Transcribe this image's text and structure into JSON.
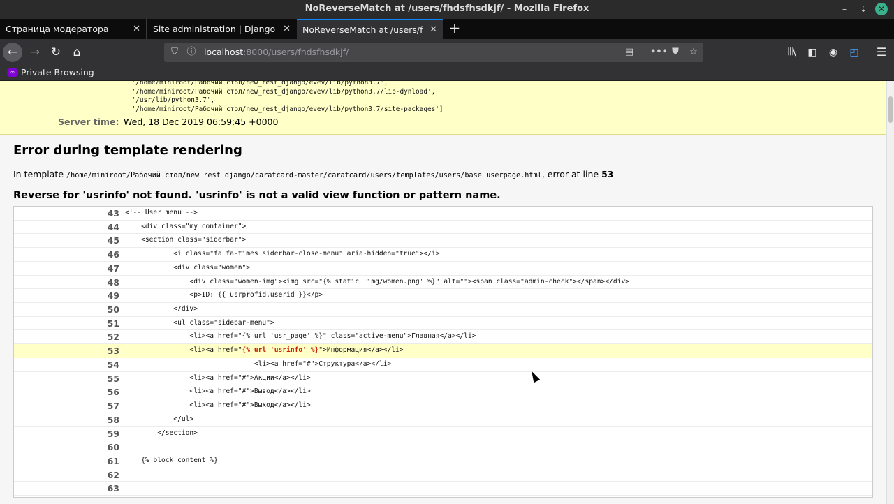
{
  "window": {
    "title": "NoReverseMatch at /users/fhdsfhsdkjf/ - Mozilla Firefox",
    "min_icon": "minimize-icon",
    "max_icon": "maximize-icon",
    "close_icon": "close-icon",
    "min_glyph": "–",
    "max_glyph": "⇣",
    "close_glyph": "✕"
  },
  "tabs": [
    {
      "label": "Страница модератора",
      "close": "✕"
    },
    {
      "label": "Site administration | Django site admin",
      "close": "✕"
    },
    {
      "label": "NoReverseMatch at /users/fhdsfhsdkjf/",
      "close": "✕",
      "active": true
    }
  ],
  "new_tab": "+",
  "nav": {
    "back": "←",
    "forward": "→",
    "reload": "↻",
    "home": "⌂",
    "url_host": "localhost",
    "url_rest": ":8000/users/fhdsfhsdkjf/",
    "shield_glyph": "⛉",
    "info_glyph": "ⓘ",
    "reader_glyph": "▤",
    "more_glyph": "•••",
    "pocket_glyph": "⛊",
    "star_glyph": "☆",
    "library_glyph": "𝄃𝄃\\",
    "sidebar_glyph": "◧",
    "account_glyph": "◉",
    "screenshot_glyph": "◰",
    "menu_glyph": "☰"
  },
  "private_browsing": {
    "label": "Private Browsing",
    "icon_glyph": "∞"
  },
  "python_path": [
    " '/home/miniroot/Рабочий стол/new_rest_django/evev/lib/python3.7',",
    " '/home/miniroot/Рабочий стол/new_rest_django/evev/lib/python3.7/lib-dynload',",
    " '/usr/lib/python3.7',",
    " '/home/miniroot/Рабочий стол/new_rest_django/evev/lib/python3.7/site-packages']"
  ],
  "server_time": {
    "label": "Server time:",
    "value": "Wed, 18 Dec 2019 06:59:45 +0000"
  },
  "template_error": {
    "heading": "Error during template rendering",
    "in_template": "In template",
    "template_path": "/home/miniroot/Рабочий стол/new_rest_django/caratcard-master/caratcard/users/templates/users/base_userpage.html",
    "error_at_line": ", error at line",
    "line": "53",
    "message": "Reverse for 'usrinfo' not found. 'usrinfo' is not a valid view function or pattern name."
  },
  "source_lines": [
    {
      "num": "43",
      "code": "<!-- User menu -->"
    },
    {
      "num": "44",
      "code": "    <div class=\"my_container\">"
    },
    {
      "num": "45",
      "code": "    <section class=\"siderbar\">"
    },
    {
      "num": "46",
      "code": "            <i class=\"fa fa-times siderbar-close-menu\" aria-hidden=\"true\"></i>"
    },
    {
      "num": "47",
      "code": "            <div class=\"women\">"
    },
    {
      "num": "48",
      "code": "                <div class=\"women-img\"><img src=\"{% static 'img/women.png' %}\" alt=\"\"><span class=\"admin-check\"></span></div>"
    },
    {
      "num": "49",
      "code": "                <p>ID: {{ usrprofid.userid }}</p>"
    },
    {
      "num": "50",
      "code": "            </div>"
    },
    {
      "num": "51",
      "code": "            <ul class=\"sidebar-menu\">"
    },
    {
      "num": "52",
      "code": "                <li><a href=\"{% url 'usr_page' %}\" class=\"active-menu\">Главная</a></li>"
    },
    {
      "num": "53",
      "code_before": "                <li><a href=\"",
      "code_error": "{% url 'usrinfo' %}",
      "code_after": "\">Информация</a></li>",
      "highlighted": true
    },
    {
      "num": "54",
      "code": "                                <li><a href=\"#\">Структура</a></li>"
    },
    {
      "num": "55",
      "code": "                <li><a href=\"#\">Акции</a></li>"
    },
    {
      "num": "56",
      "code": "                <li><a href=\"#\">Вывод</a></li>"
    },
    {
      "num": "57",
      "code": "                <li><a href=\"#\">Выход</a></li>"
    },
    {
      "num": "58",
      "code": "            </ul>"
    },
    {
      "num": "59",
      "code": "        </section>"
    },
    {
      "num": "60",
      "code": ""
    },
    {
      "num": "61",
      "code": "    {% block content %}"
    },
    {
      "num": "62",
      "code": ""
    },
    {
      "num": "63",
      "code": ""
    }
  ]
}
